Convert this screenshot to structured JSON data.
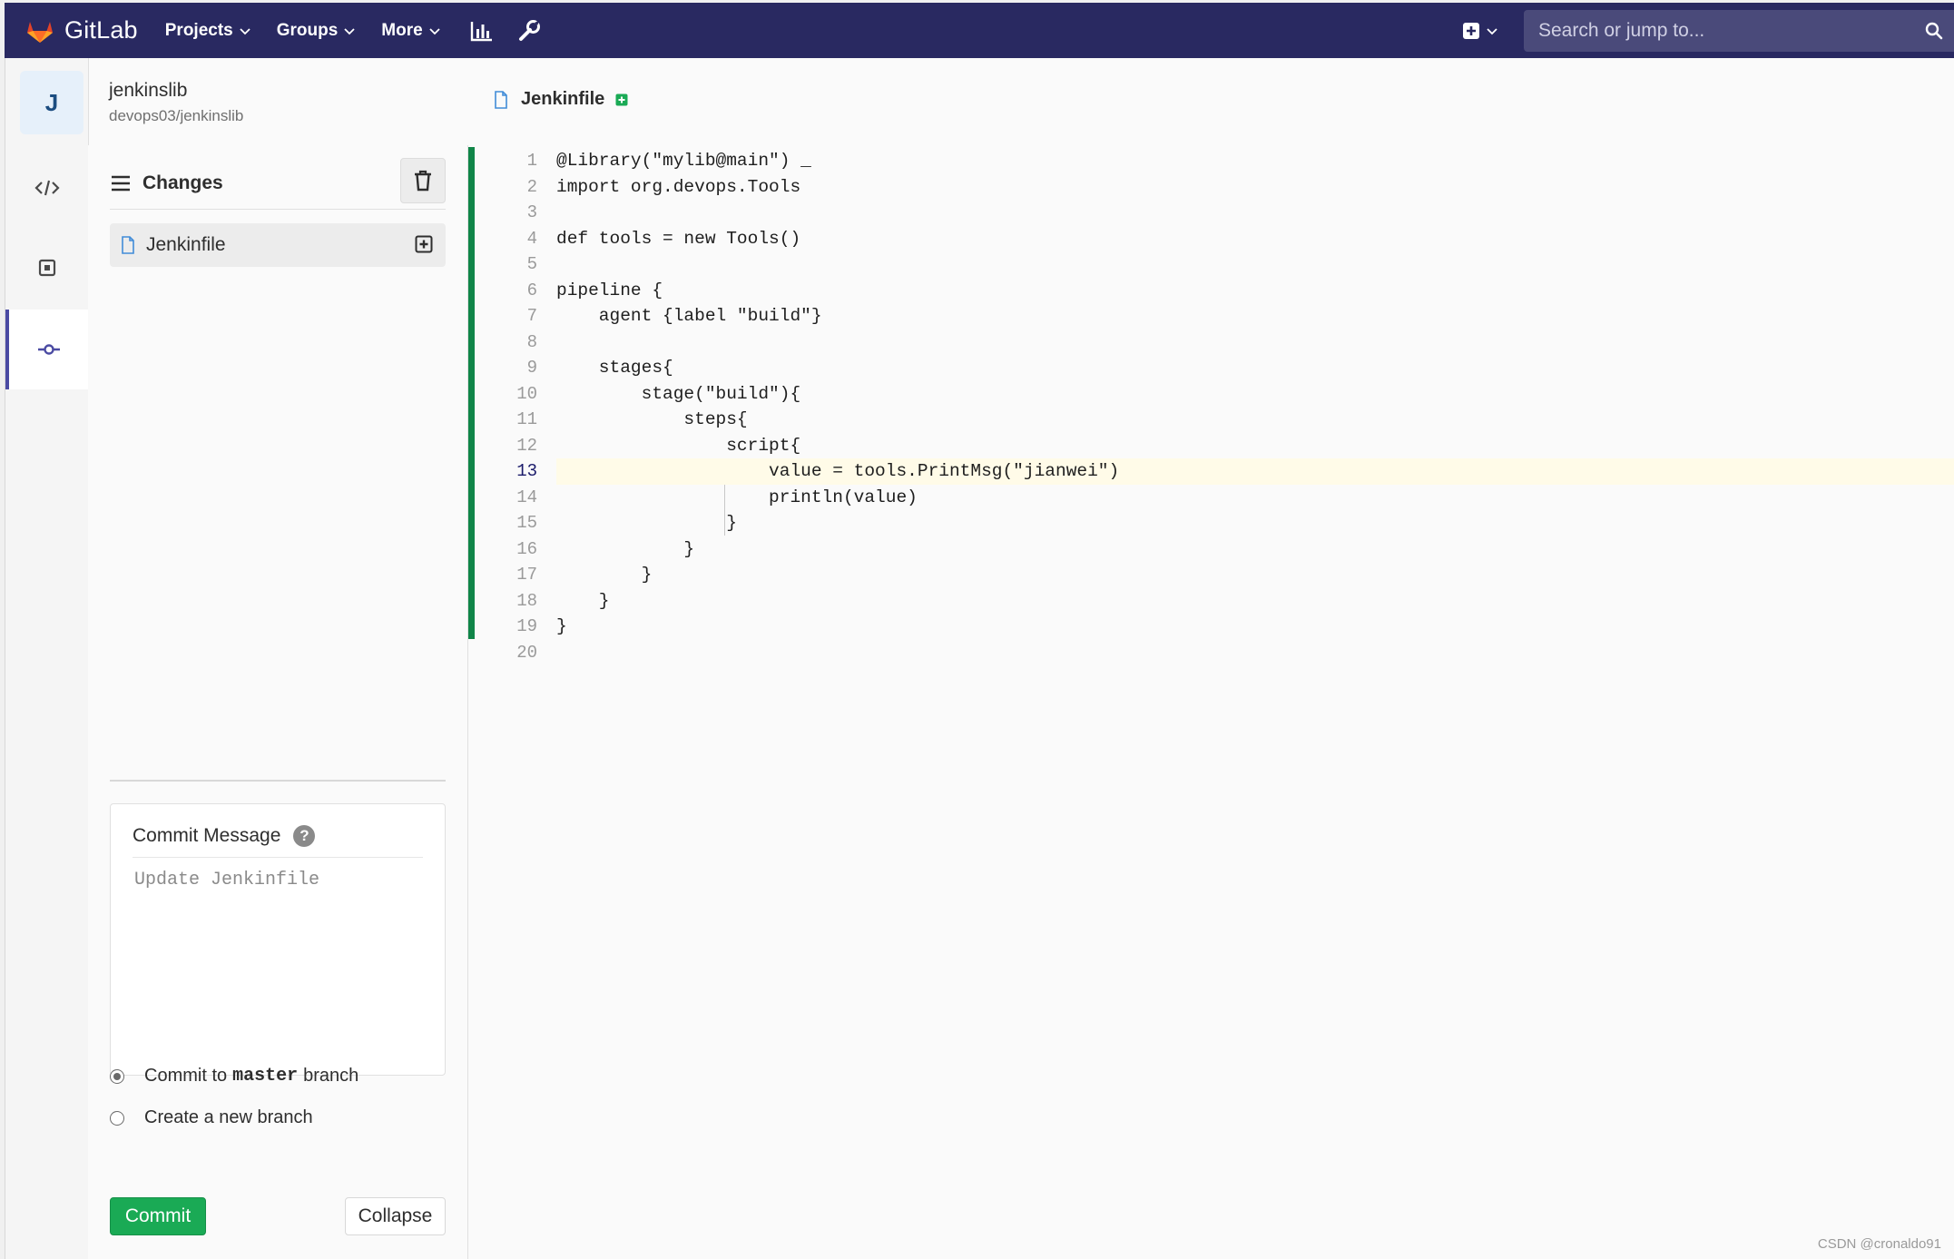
{
  "navbar": {
    "brand": "GitLab",
    "items": [
      {
        "label": "Projects"
      },
      {
        "label": "Groups"
      },
      {
        "label": "More"
      }
    ],
    "search_placeholder": "Search or jump to..."
  },
  "project": {
    "avatar_letter": "J",
    "name": "jenkinslib",
    "path": "devops03/jenkinslib"
  },
  "changes": {
    "title": "Changes",
    "files": [
      {
        "name": "Jenkinfile"
      }
    ]
  },
  "commit": {
    "message_label": "Commit Message",
    "help_glyph": "?",
    "message_placeholder": "Update Jenkinfile",
    "option_master_prefix": "Commit to",
    "option_master_branch": "master",
    "option_master_suffix": "branch",
    "option_new_branch": "Create a new branch",
    "commit_button": "Commit",
    "collapse_button": "Collapse"
  },
  "editor": {
    "file_name": "Jenkinfile",
    "current_line": 13,
    "lines": [
      "@Library(\"mylib@main\") _",
      "import org.devops.Tools",
      "",
      "def tools = new Tools()",
      "",
      "pipeline {",
      "    agent {label \"build\"}",
      "",
      "    stages{",
      "        stage(\"build\"){",
      "            steps{",
      "                script{",
      "                    value = tools.PrintMsg(\"jianwei\")",
      "                    println(value)",
      "                }",
      "            }",
      "        }",
      "    }",
      "}",
      ""
    ]
  },
  "watermark": "CSDN @cronaldo91",
  "colors": {
    "navbar": "#292961",
    "commit_button": "#1aaa55",
    "change_bar": "#108548",
    "active_rail": "#4b4ba3"
  }
}
